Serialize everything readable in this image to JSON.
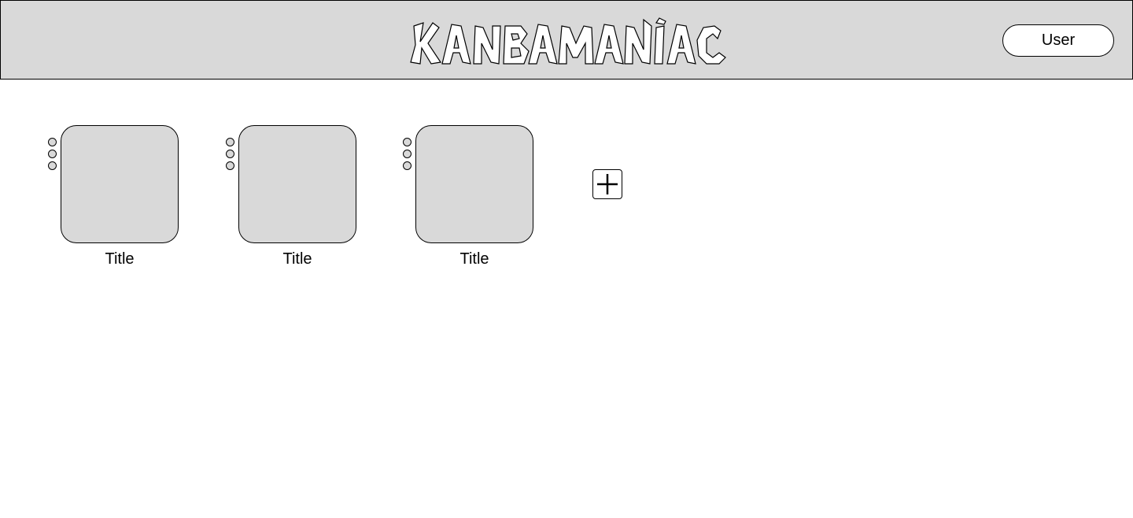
{
  "header": {
    "logo_text": "KANBAMANIAC",
    "user_button_label": "User",
    "background_color": "#d9d9d9"
  },
  "boards": [
    {
      "title": "Title"
    },
    {
      "title": "Title"
    },
    {
      "title": "Title"
    }
  ],
  "add_board": {
    "icon": "plus-icon"
  }
}
